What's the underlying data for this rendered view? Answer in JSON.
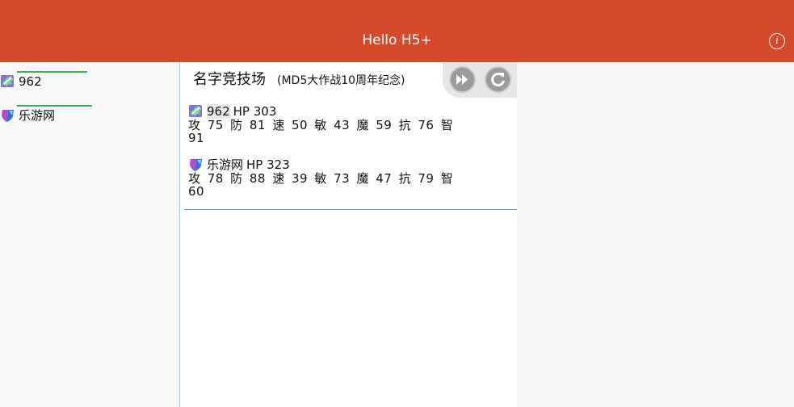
{
  "header": {
    "title": "Hello H5+",
    "info_label": "i"
  },
  "players": [
    {
      "name": "962",
      "avatar": "badge-icon-green",
      "hp_fraction": 0.95
    },
    {
      "name": "乐游网",
      "avatar": "shield-icon-blue",
      "hp_fraction": 1.0
    }
  ],
  "battle": {
    "title": "名字竞技场",
    "subtitle": "(MD5大作战10周年纪念)",
    "fast_forward_icon": "fast-forward-icon",
    "refresh_icon": "refresh-icon",
    "entries": [
      {
        "name": "962",
        "hp_text": "HP  303",
        "stats_line1": "攻 75 防 81 速 50 敏 43 魔 59 抗 76 智",
        "stats_line2": "91"
      },
      {
        "name": "乐游网",
        "hp_text": "HP  323",
        "stats_line1": "攻 78 防 88 速 39 敏 73 魔 47 抗 79 智",
        "stats_line2": "60"
      }
    ]
  },
  "colors": {
    "header_bg": "#d54a28",
    "hp_bar": "#3ab54a",
    "control_btn": "#9b9b9b"
  }
}
